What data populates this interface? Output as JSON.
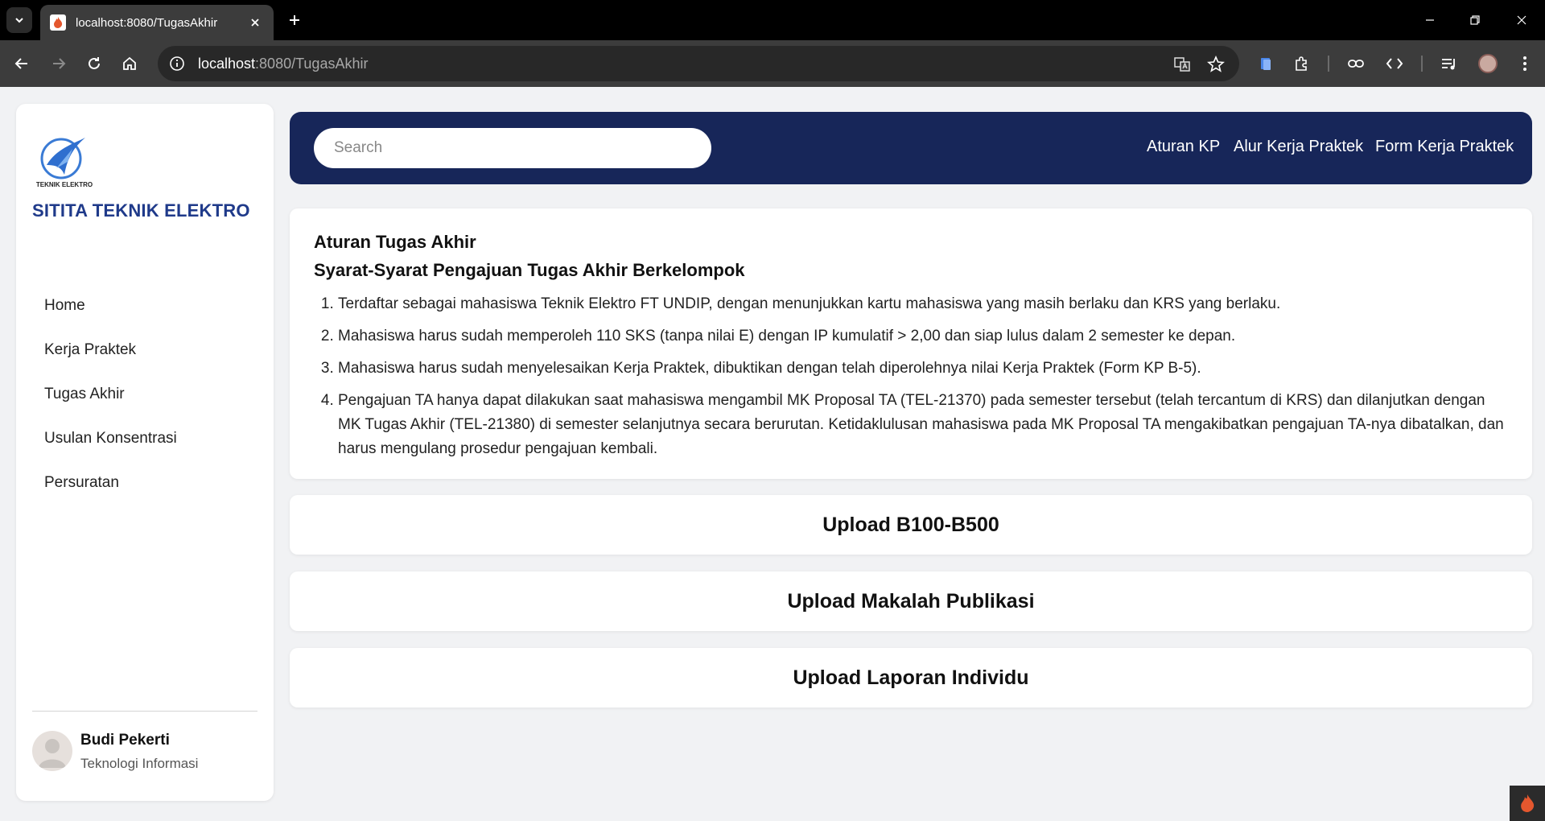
{
  "browser": {
    "tab_title": "localhost:8080/TugasAkhir",
    "url_host": "localhost",
    "url_rest": ":8080/TugasAkhir"
  },
  "sidebar": {
    "logo_caption": "TEKNIK ELEKTRO",
    "brand": "SITITA TEKNIK ELEKTRO",
    "nav": [
      {
        "label": "Home"
      },
      {
        "label": "Kerja Praktek"
      },
      {
        "label": "Tugas Akhir"
      },
      {
        "label": "Usulan Konsentrasi"
      },
      {
        "label": "Persuratan"
      }
    ],
    "user": {
      "name": "Budi Pekerti",
      "dept": "Teknologi Informasi"
    }
  },
  "topbar": {
    "search_placeholder": "Search",
    "links": [
      {
        "label": "Aturan KP"
      },
      {
        "label": "Alur Kerja Praktek"
      },
      {
        "label": "Form Kerja Praktek"
      }
    ]
  },
  "rules": {
    "title": "Aturan Tugas Akhir",
    "subtitle": "Syarat-Syarat Pengajuan Tugas Akhir Berkelompok",
    "items": [
      "Terdaftar sebagai mahasiswa Teknik Elektro FT UNDIP, dengan menunjukkan kartu mahasiswa yang masih berlaku dan KRS yang berlaku.",
      "Mahasiswa harus sudah memperoleh 110 SKS (tanpa nilai E) dengan IP kumulatif > 2,00 dan siap lulus dalam 2 semester ke depan.",
      "Mahasiswa harus sudah menyelesaikan Kerja Praktek, dibuktikan dengan telah diperolehnya nilai Kerja Praktek (Form KP B-5).",
      "Pengajuan TA hanya dapat dilakukan saat mahasiswa mengambil MK Proposal TA (TEL-21370) pada semester tersebut (telah tercantum di KRS) dan dilanjutkan dengan MK Tugas Akhir (TEL-21380) di semester selanjutnya secara berurutan. Ketidaklulusan mahasiswa pada MK Proposal TA mengakibatkan pengajuan TA-nya dibatalkan, dan harus mengulang prosedur pengajuan kembali."
    ]
  },
  "uploads": [
    {
      "label": "Upload B100-B500"
    },
    {
      "label": "Upload Makalah Publikasi"
    },
    {
      "label": "Upload Laporan Individu"
    }
  ],
  "colors": {
    "brand": "#1f3a8a",
    "topbar": "#172659",
    "page_bg": "#f1f2f4"
  }
}
